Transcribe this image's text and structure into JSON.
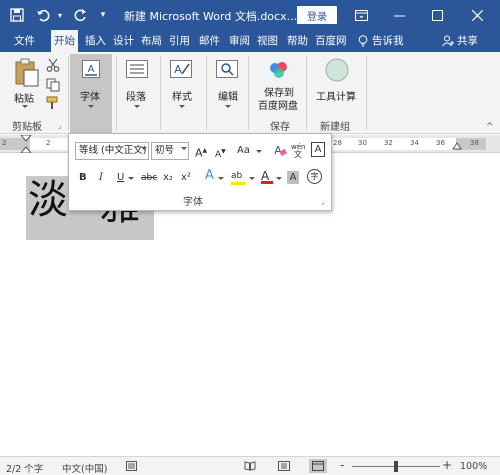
{
  "titlebar": {
    "title": "新建 Microsoft Word 文档.docx...",
    "login_label": "登录",
    "icons": [
      "save-icon",
      "undo-icon",
      "redo-icon",
      "customize-icon",
      "ribbon-display-icon",
      "minimize-icon",
      "restore-icon",
      "close-icon"
    ]
  },
  "tabs": [
    "文件",
    "开始",
    "插入",
    "设计",
    "布局",
    "引用",
    "邮件",
    "审阅",
    "视图",
    "帮助",
    "百度网",
    "告诉我",
    "共享"
  ],
  "ribbon": {
    "paste_label": "粘贴",
    "clipboard_label": "剪贴板",
    "font_label": "字体",
    "paragraph_label": "段落",
    "styles_label": "样式",
    "editing_label": "编辑",
    "save_baidu_line1": "保存到",
    "save_baidu_line2": "百度网盘",
    "save_group_label": "保存",
    "tool_calc_label": "工具计算",
    "new_group_label": "新建组"
  },
  "ruler": {
    "numbers": [
      "2",
      "2",
      "28",
      "30",
      "32",
      "34",
      "36",
      "38"
    ]
  },
  "font_panel": {
    "font_name": "等线 (中文正文)",
    "font_size": "初号",
    "grow_label": "A",
    "shrink_label": "A",
    "case_label": "Aa",
    "phonetic_top": "wén",
    "phonetic_bottom": "文",
    "border_label": "A",
    "bold": "B",
    "italic": "I",
    "underline": "U",
    "strike": "abc",
    "subscript": "x₂",
    "superscript": "x²",
    "effects": "A",
    "highlight": "ab",
    "color": "A",
    "shading": "A",
    "circle": "字",
    "group_label": "字体",
    "accent_highlight": "#f2e600",
    "accent_color": "#e02020"
  },
  "document": {
    "char1": "淡",
    "char2": "雅"
  },
  "statusbar": {
    "pages": "2/2 个字",
    "language": "中文(中国)",
    "zoom_minus": "-",
    "zoom_plus": "+",
    "zoom": "100%",
    "zoom_level_pct": 50
  }
}
